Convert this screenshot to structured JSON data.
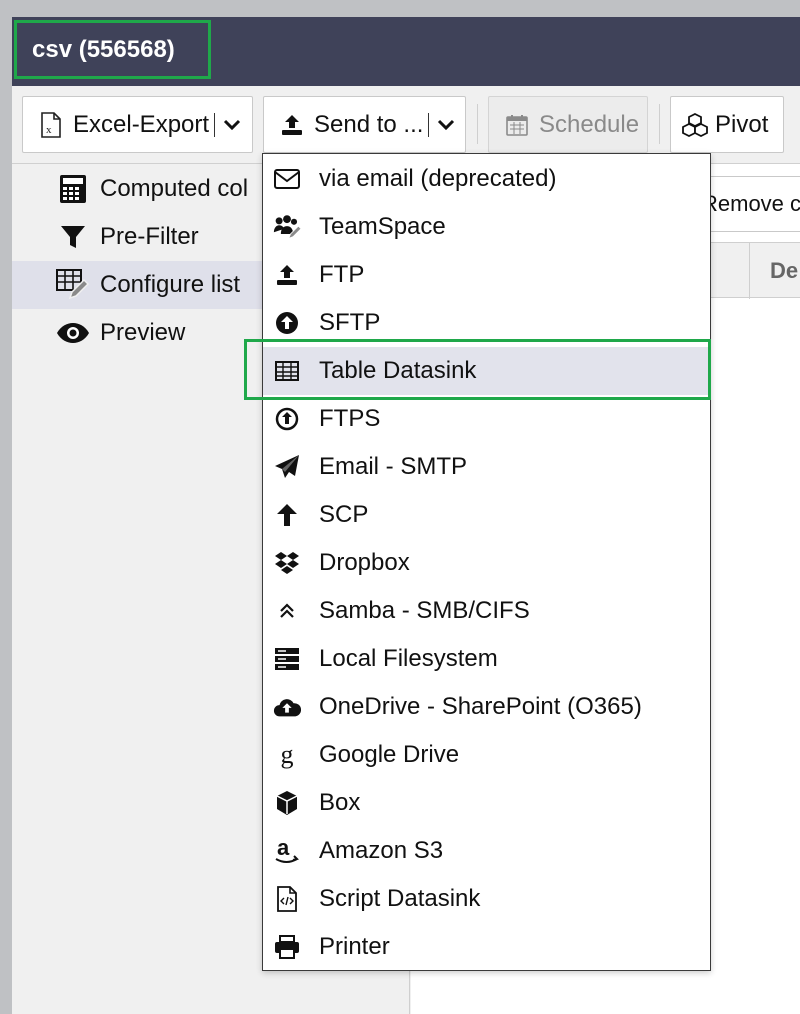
{
  "window": {
    "title": "csv (556568)"
  },
  "toolbar": {
    "excel_export": "Excel-Export",
    "send_to": "Send to ...",
    "schedule": "Schedule",
    "pivot": "Pivot"
  },
  "sidebar": {
    "items": [
      {
        "label": "Computed col",
        "icon": "calculator-icon"
      },
      {
        "label": "Pre-Filter",
        "icon": "filter-icon"
      },
      {
        "label": "Configure list",
        "icon": "table-edit-icon",
        "active": true
      },
      {
        "label": "Preview",
        "icon": "eye-icon"
      }
    ]
  },
  "main": {
    "remove_button": "Remove c",
    "table_header_cell": "De"
  },
  "send_menu": {
    "items": [
      {
        "label": "via email (deprecated)",
        "icon": "envelope-icon"
      },
      {
        "label": "TeamSpace",
        "icon": "users-edit-icon"
      },
      {
        "label": "FTP",
        "icon": "upload-icon"
      },
      {
        "label": "SFTP",
        "icon": "circle-up-icon"
      },
      {
        "label": "Table Datasink",
        "icon": "table-icon",
        "active": true
      },
      {
        "label": "FTPS",
        "icon": "circle-up-outline-icon"
      },
      {
        "label": "Email - SMTP",
        "icon": "paper-plane-icon"
      },
      {
        "label": "SCP",
        "icon": "arrow-up-icon"
      },
      {
        "label": "Dropbox",
        "icon": "dropbox-icon"
      },
      {
        "label": "Samba - SMB/CIFS",
        "icon": "double-chevron-up-icon"
      },
      {
        "label": "Local Filesystem",
        "icon": "server-icon"
      },
      {
        "label": "OneDrive - SharePoint (O365)",
        "icon": "cloud-upload-icon"
      },
      {
        "label": "Google Drive",
        "icon": "google-icon"
      },
      {
        "label": "Box",
        "icon": "cube-icon"
      },
      {
        "label": "Amazon S3",
        "icon": "amazon-icon"
      },
      {
        "label": "Script Datasink",
        "icon": "code-file-icon"
      },
      {
        "label": "Printer",
        "icon": "printer-icon"
      }
    ]
  },
  "colors": {
    "titlebar": "#3f4259",
    "highlight": "#1fa84a",
    "active_row": "#e2e3ec"
  }
}
